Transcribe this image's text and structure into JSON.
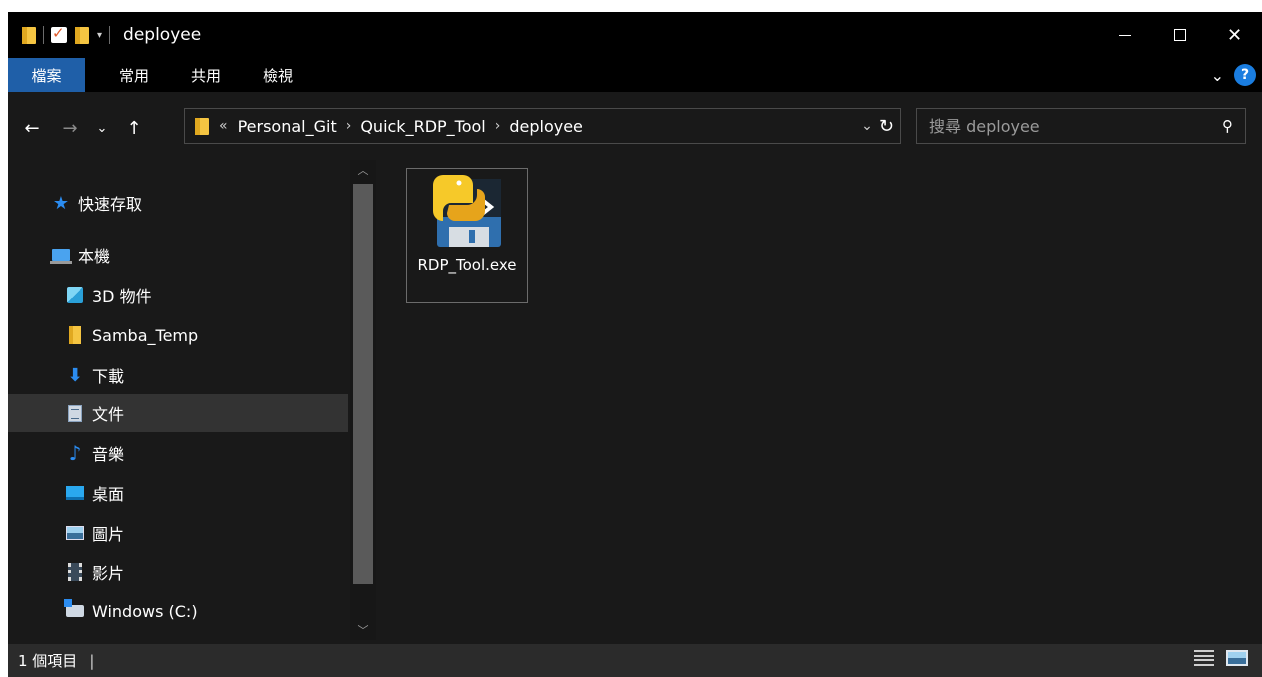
{
  "window": {
    "title": "deployee"
  },
  "ribbon": {
    "tabs": [
      "檔案",
      "常用",
      "共用",
      "檢視"
    ],
    "help_label": "?"
  },
  "address": {
    "lead": "«",
    "crumbs": [
      "Personal_Git",
      "Quick_RDP_Tool",
      "deployee"
    ]
  },
  "search": {
    "placeholder": "搜尋 deployee"
  },
  "nav": {
    "items": [
      {
        "label": "快速存取",
        "icon": "star-icon"
      },
      {
        "label": "本機",
        "icon": "pc-icon"
      },
      {
        "label": "3D 物件",
        "icon": "cube-icon"
      },
      {
        "label": "Samba_Temp",
        "icon": "folder-icon"
      },
      {
        "label": "下載",
        "icon": "download-icon"
      },
      {
        "label": "文件",
        "icon": "document-icon",
        "selected": true
      },
      {
        "label": "音樂",
        "icon": "music-icon"
      },
      {
        "label": "桌面",
        "icon": "desktop-icon"
      },
      {
        "label": "圖片",
        "icon": "pictures-icon"
      },
      {
        "label": "影片",
        "icon": "videos-icon"
      },
      {
        "label": "Windows (C:)",
        "icon": "drive-icon"
      }
    ]
  },
  "files": [
    {
      "name": "RDP_Tool.exe",
      "icon": "python-exe-icon"
    }
  ],
  "status": {
    "count": "1 個項目",
    "sep": "|"
  },
  "colors": {
    "accent": "#1f5fa8",
    "background": "#191919",
    "selected": "#333333"
  }
}
